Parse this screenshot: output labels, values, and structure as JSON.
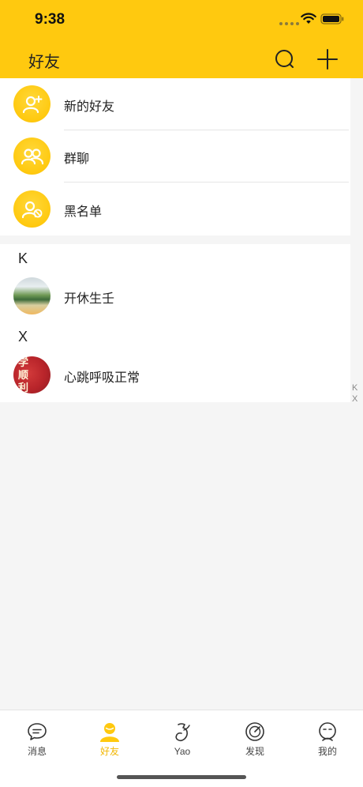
{
  "status_bar": {
    "time": "9:38"
  },
  "nav": {
    "title": "好友",
    "search_icon": "search-icon",
    "add_icon": "plus-icon"
  },
  "functions": [
    {
      "label": "新的好友",
      "icon": "add-user-icon"
    },
    {
      "label": "群聊",
      "icon": "group-icon"
    },
    {
      "label": "黑名单",
      "icon": "block-user-icon"
    }
  ],
  "sections": [
    {
      "letter": "K",
      "contacts": [
        {
          "name": "开休生壬"
        }
      ]
    },
    {
      "letter": "X",
      "contacts": [
        {
          "name": "心跳呼吸正常",
          "avatar_text": [
            "学",
            "顺",
            "利"
          ]
        }
      ]
    }
  ],
  "index_letters": [
    "K",
    "X"
  ],
  "tabs": [
    {
      "label": "消息",
      "icon": "message-icon",
      "active": false
    },
    {
      "label": "好友",
      "icon": "friends-icon",
      "active": true
    },
    {
      "label": "Yao",
      "icon": "yao-icon",
      "active": false
    },
    {
      "label": "发现",
      "icon": "discover-icon",
      "active": false
    },
    {
      "label": "我的",
      "icon": "profile-icon",
      "active": false
    }
  ],
  "colors": {
    "brand": "#ffc90f",
    "active_tab": "#f2b705"
  }
}
